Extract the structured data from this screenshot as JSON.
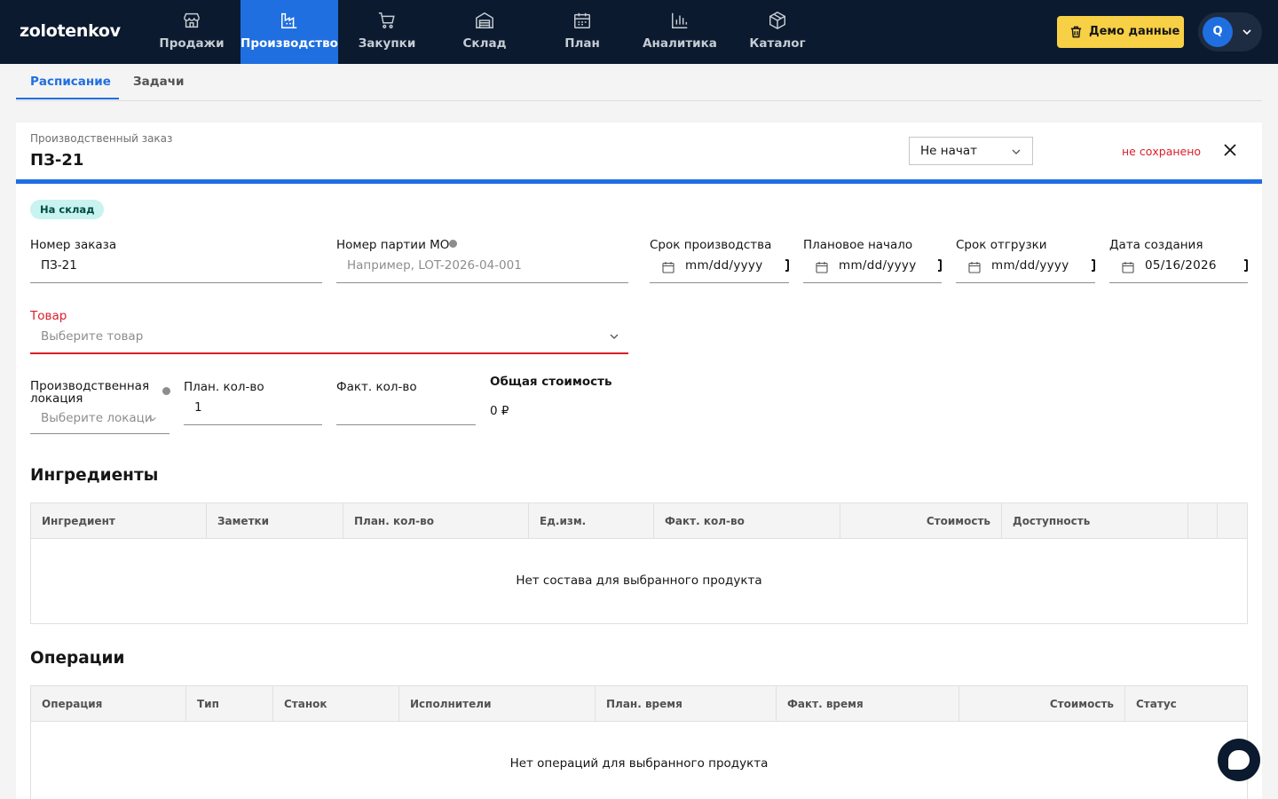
{
  "app": {
    "logo": "zolotenkov"
  },
  "nav": {
    "items": [
      {
        "label": "Продажи",
        "icon": "store-icon"
      },
      {
        "label": "Производство",
        "icon": "factory-icon"
      },
      {
        "label": "Закупки",
        "icon": "cart-icon"
      },
      {
        "label": "Склад",
        "icon": "warehouse-icon"
      },
      {
        "label": "План",
        "icon": "calendar-icon"
      },
      {
        "label": "Аналитика",
        "icon": "bar-chart-icon"
      },
      {
        "label": "Каталог",
        "icon": "package-icon"
      }
    ],
    "active_index": 1,
    "demo_button": "Демо данные",
    "user_initial": "Q"
  },
  "subtabs": [
    "Расписание",
    "Задачи"
  ],
  "order": {
    "caption": "Производственный заказ",
    "title": "ПЗ-21",
    "status": "Не начат",
    "unsaved": "не сохранено",
    "tag": "На склад"
  },
  "form": {
    "order_number": {
      "label": "Номер заказа",
      "value": "ПЗ-21"
    },
    "batch_number": {
      "label": "Номер партии МО",
      "placeholder": "Например, LOT-2026-04-001"
    },
    "production_deadline": {
      "label": "Срок производства",
      "value": "mm/dd/yyyy"
    },
    "planned_start": {
      "label": "Плановое начало",
      "value": "mm/dd/yyyy"
    },
    "shipping_deadline": {
      "label": "Срок отгрузки",
      "value": "mm/dd/yyyy"
    },
    "created_date": {
      "label": "Дата создания",
      "value": "05/16/2026"
    },
    "product": {
      "label": "Товар",
      "placeholder": "Выберите товар"
    },
    "location": {
      "label_line1": "Производственная",
      "label_line2": "локация",
      "placeholder": "Выберите локаци"
    },
    "planned_qty": {
      "label": "План. кол-во",
      "value": "1"
    },
    "actual_qty": {
      "label": "Факт. кол-во",
      "value": ""
    },
    "total_cost": {
      "label": "Общая стоимость",
      "value": "0 ₽"
    }
  },
  "ingredients": {
    "title": "Ингредиенты",
    "columns": [
      "Ингредиент",
      "Заметки",
      "План. кол-во",
      "Ед.изм.",
      "Факт. кол-во",
      "Стоимость",
      "Доступность",
      "",
      ""
    ],
    "empty": "Нет состава для выбранного продукта"
  },
  "operations": {
    "title": "Операции",
    "columns": [
      "Операция",
      "Тип",
      "Станок",
      "Исполнители",
      "План. время",
      "Факт. время",
      "Стоимость",
      "Статус"
    ],
    "empty": "Нет операций для выбранного продукта"
  }
}
